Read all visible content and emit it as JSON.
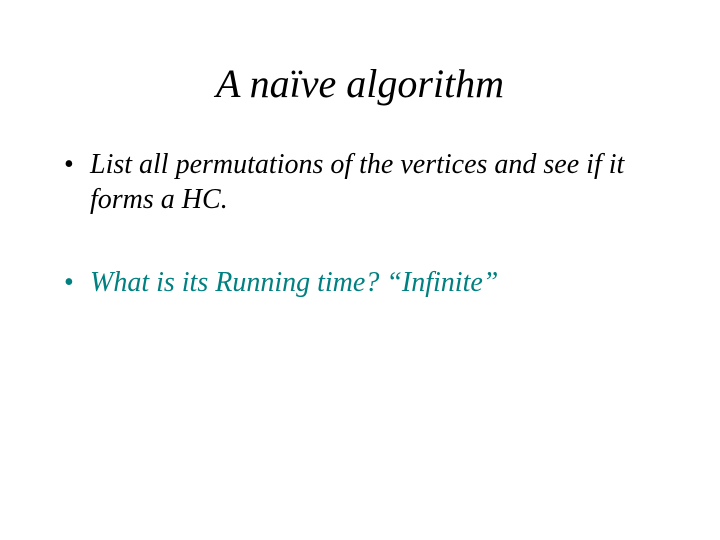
{
  "title": "A naïve algorithm",
  "bullets": {
    "b1": "List all permutations of the vertices and see if it forms a HC.",
    "b2_prefix": "What is its Running time? ",
    "b2_answer": "“Infinite”"
  }
}
